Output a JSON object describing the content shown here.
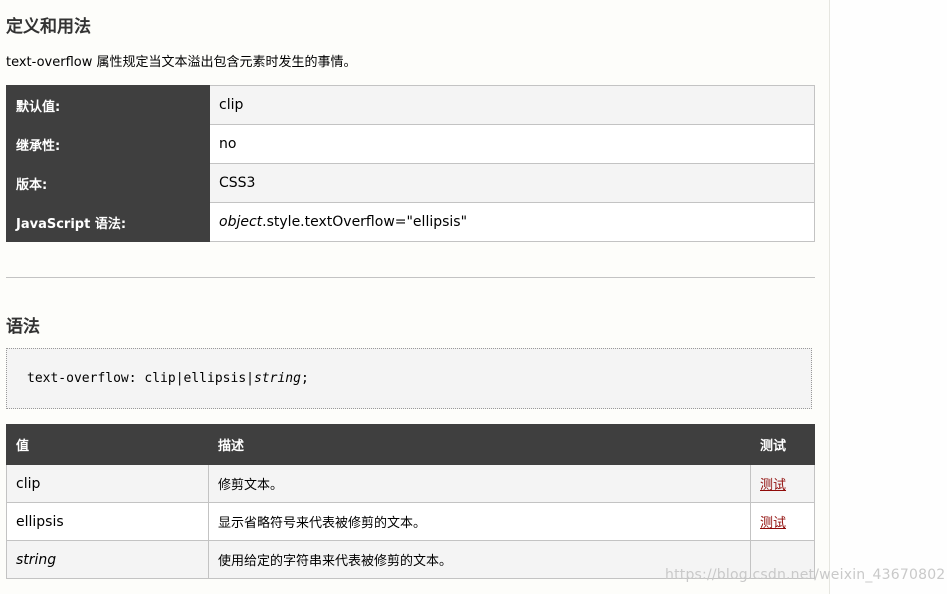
{
  "sections": {
    "definition_title": "定义和用法",
    "intro_prefix": "text-overflow",
    "intro_suffix": " 属性规定当文本溢出包含元素时发生的事情。",
    "syntax_title": "语法"
  },
  "properties": [
    {
      "key": "默认值:",
      "value": "clip"
    },
    {
      "key": "继承性:",
      "value": "no"
    },
    {
      "key": "版本:",
      "value": "CSS3"
    },
    {
      "key": "JavaScript 语法:",
      "value_italic": "object",
      "value_rest": ".style.textOverflow=\"ellipsis\""
    }
  ],
  "syntax": {
    "code_prefix": "text-overflow: clip|ellipsis|",
    "code_italic": "string",
    "code_suffix": ";"
  },
  "values_table": {
    "headers": [
      "值",
      "描述",
      "测试"
    ],
    "rows": [
      {
        "value": "clip",
        "desc": "修剪文本。",
        "test": "测试"
      },
      {
        "value": "ellipsis",
        "desc": "显示省略符号来代表被修剪的文本。",
        "test": "测试"
      },
      {
        "value": "string",
        "desc": "使用给定的字符串来代表被修剪的文本。",
        "test": ""
      }
    ]
  },
  "watermark": "https://blog.csdn.net/weixin_43670802"
}
